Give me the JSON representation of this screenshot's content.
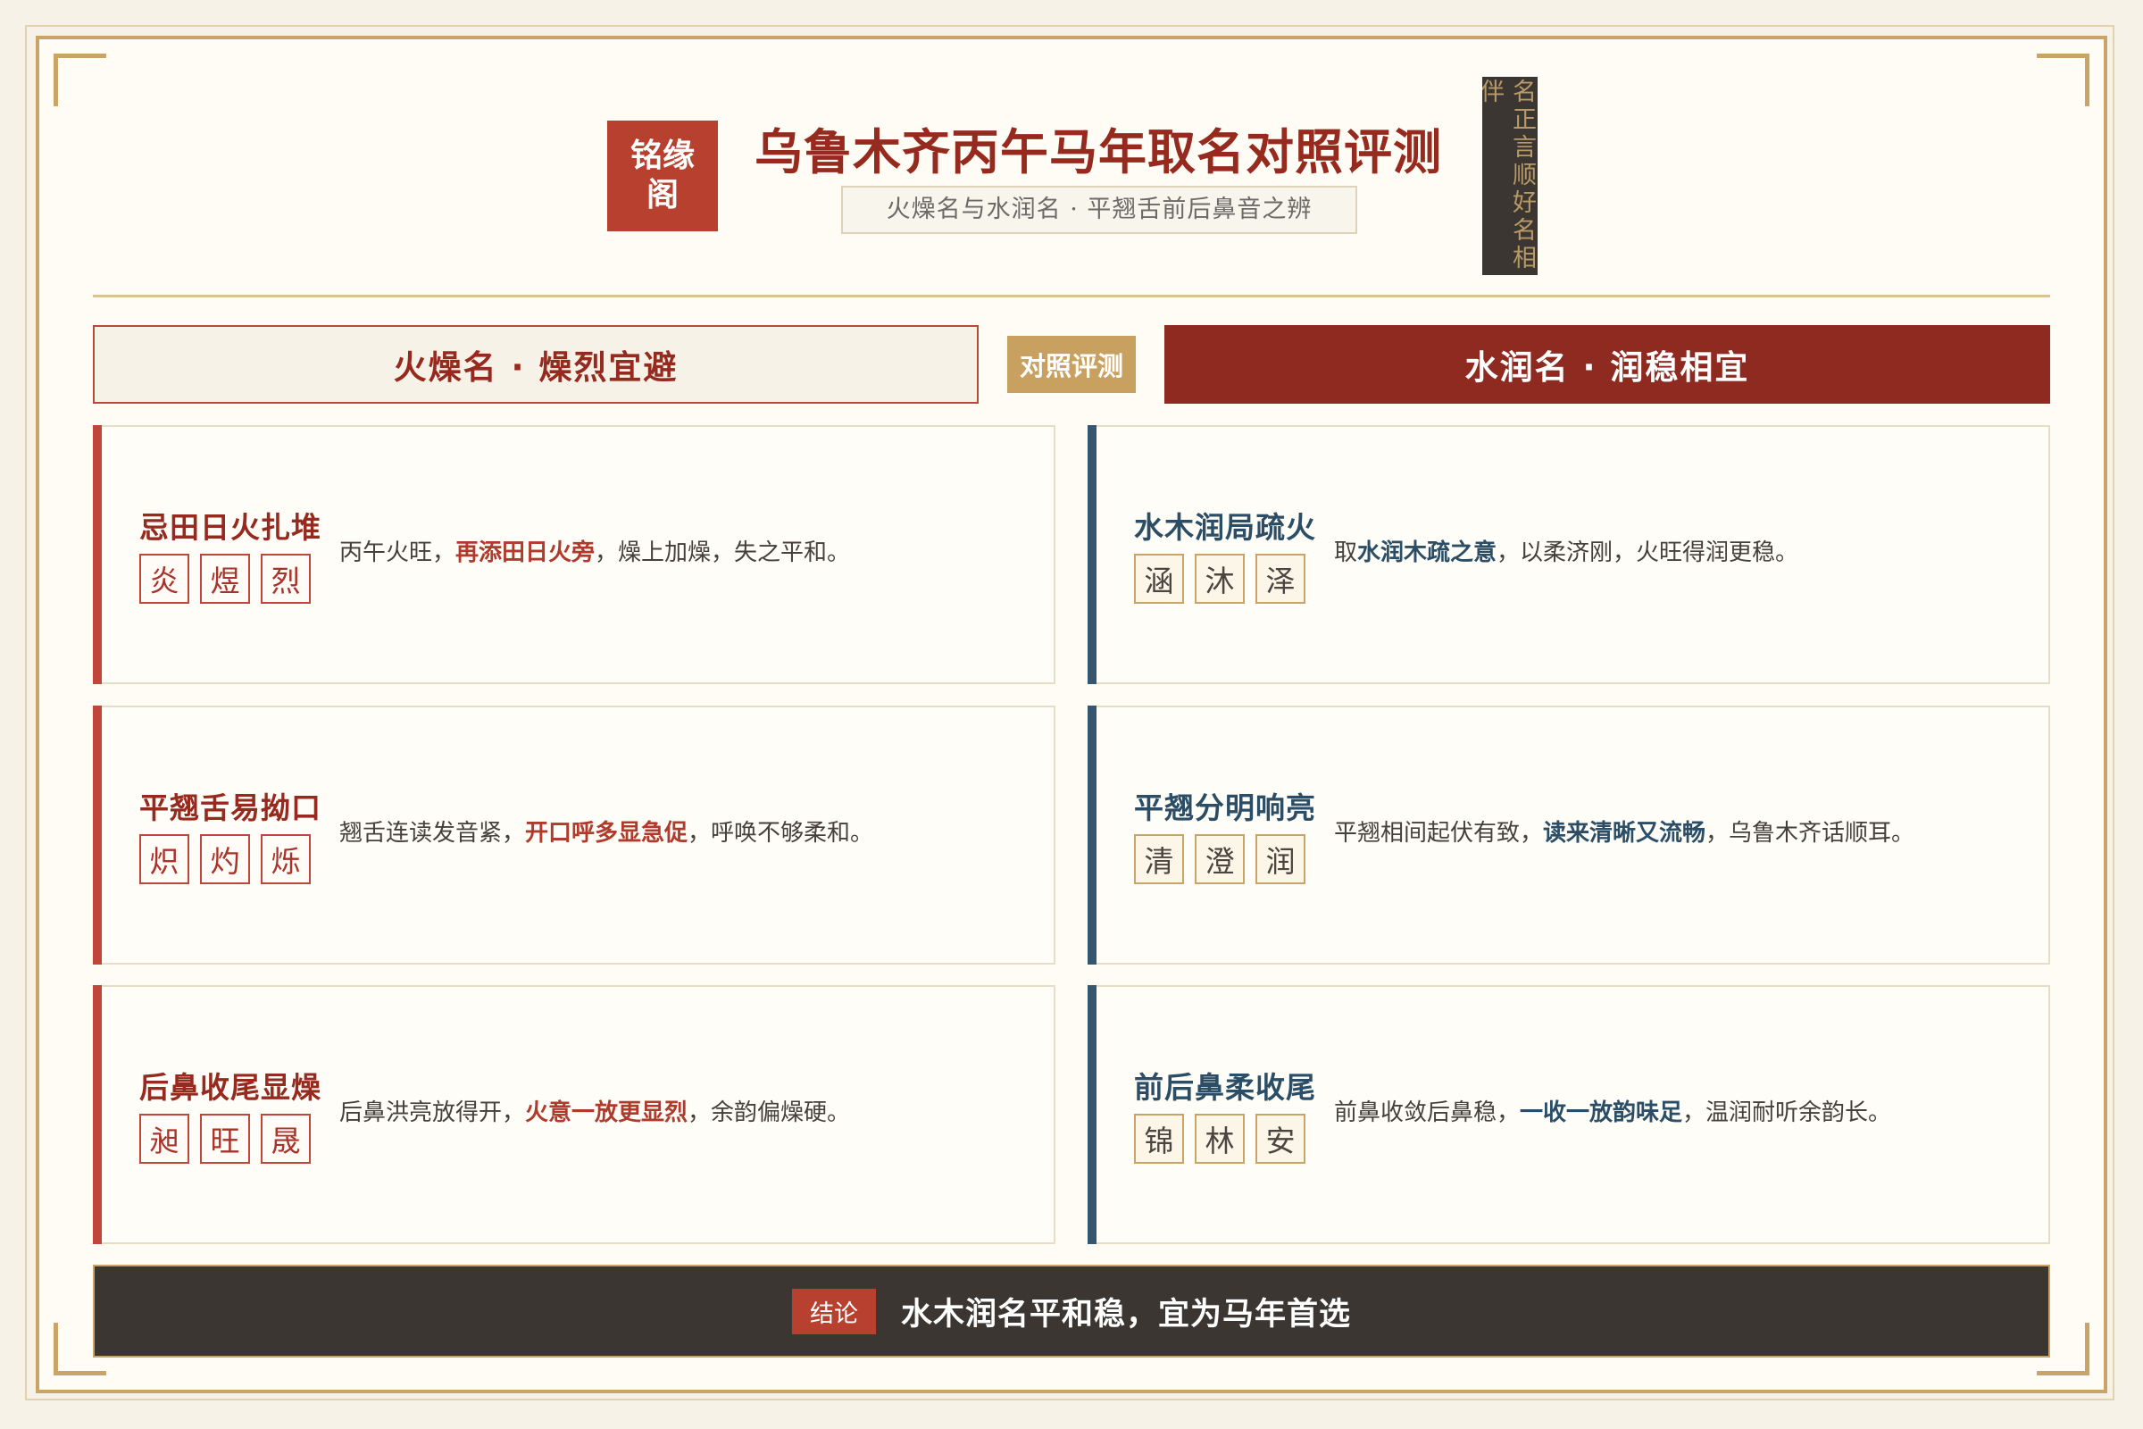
{
  "header": {
    "logo": "铭缘阁",
    "title": "乌鲁木齐丙午马年取名对照评测",
    "subtitle": "火燥名与水润名 · 平翘舌前后鼻音之辨",
    "seal": "名正言顺好名相伴"
  },
  "columns": {
    "fire_title": "火燥名 · 燥烈宜避",
    "vs_label": "对照评测",
    "water_title": "水润名 · 润稳相宜"
  },
  "fire_cards": [
    {
      "title": "忌田日火扎堆",
      "chars": [
        "炎",
        "煜",
        "烈"
      ],
      "desc_pre": "丙午火旺，",
      "desc_em": "再添田日火旁",
      "desc_post": "，燥上加燥，失之平和。"
    },
    {
      "title": "平翘舌易拗口",
      "chars": [
        "炽",
        "灼",
        "烁"
      ],
      "desc_pre": "翘舌连读发音紧，",
      "desc_em": "开口呼多显急促",
      "desc_post": "，呼唤不够柔和。"
    },
    {
      "title": "后鼻收尾显燥",
      "chars": [
        "昶",
        "旺",
        "晟"
      ],
      "desc_pre": "后鼻洪亮放得开，",
      "desc_em": "火意一放更显烈",
      "desc_post": "，余韵偏燥硬。"
    }
  ],
  "water_cards": [
    {
      "title": "水木润局疏火",
      "chars": [
        "涵",
        "沐",
        "泽"
      ],
      "desc_pre": "取",
      "desc_em": "水润木疏之意",
      "desc_post": "，以柔济刚，火旺得润更稳。"
    },
    {
      "title": "平翘分明响亮",
      "chars": [
        "清",
        "澄",
        "润"
      ],
      "desc_pre": "平翘相间起伏有致，",
      "desc_em": "读来清晰又流畅",
      "desc_post": "，乌鲁木齐话顺耳。"
    },
    {
      "title": "前后鼻柔收尾",
      "chars": [
        "锦",
        "林",
        "安"
      ],
      "desc_pre": "前鼻收敛后鼻稳，",
      "desc_em": "一收一放韵味足",
      "desc_post": "，温润耐听余韵长。"
    }
  ],
  "conclusion": {
    "tag": "结论",
    "text": "水木润名平和稳，宜为马年首选"
  },
  "colors": {
    "accent_red": "#962a1f",
    "accent_blue": "#2c4d66",
    "gold": "#c9a466",
    "dark": "#3b3631"
  }
}
